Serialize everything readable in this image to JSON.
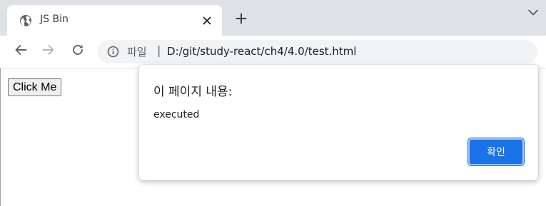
{
  "browser": {
    "tab": {
      "title": "JS Bin",
      "favicon": "globe-icon",
      "close_icon": "close-icon"
    },
    "new_tab_icon": "plus-icon",
    "tab_search_icon": "chevron-down-icon",
    "toolbar": {
      "back_icon": "arrow-left-icon",
      "forward_icon": "arrow-right-icon",
      "reload_icon": "reload-icon"
    },
    "omnibox": {
      "site_info_icon": "info-icon",
      "site_info_label": "파일",
      "separator": "|",
      "url": "D:/git/study-react/ch4/4.0/test.html"
    }
  },
  "page": {
    "button_label": "Click Me"
  },
  "alert_dialog": {
    "title": "이 페이지 내용:",
    "message": "executed",
    "ok_label": "확인"
  },
  "colors": {
    "tabstrip_bg": "#dee1e6",
    "omnibox_bg": "#f1f3f4",
    "accent": "#1a73e8",
    "text_primary": "#202124",
    "icon_gray": "#5f6368"
  }
}
